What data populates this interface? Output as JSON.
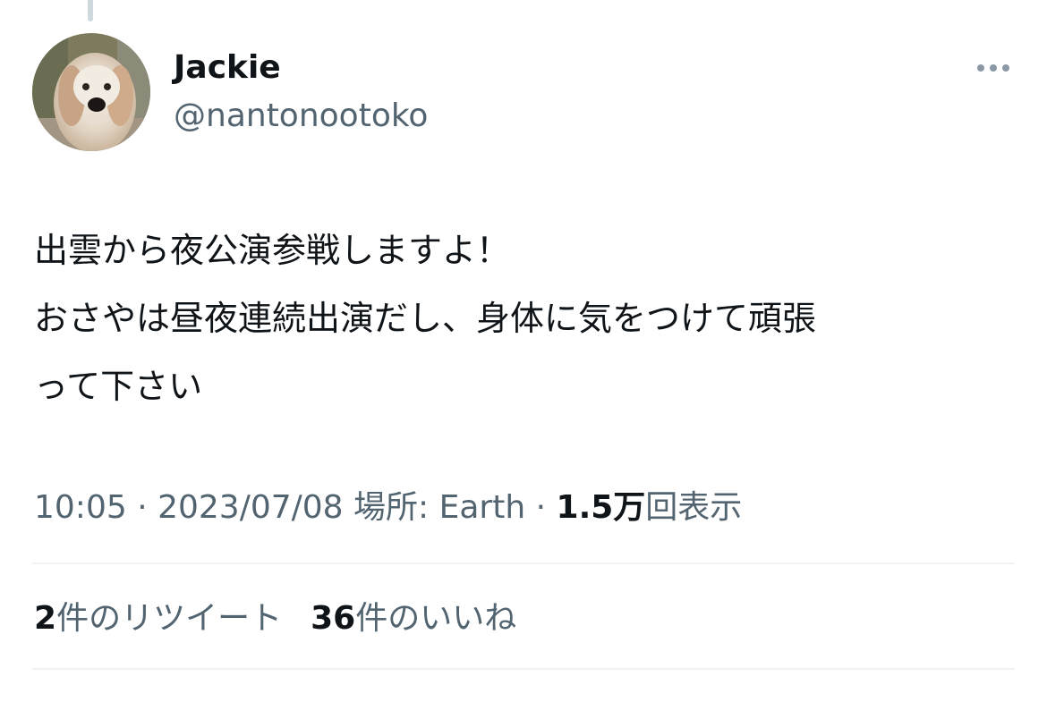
{
  "tweet": {
    "author": {
      "display_name": "Jackie",
      "handle": "@nantonootoko",
      "avatar": "dog-avatar-icon"
    },
    "more_icon": "more-horizontal-icon",
    "text_lines": [
      "出雲から夜公演参戦しますよ！",
      "おさやは昼夜連続出演だし、身体に気をつけて頑張",
      "って下さい"
    ],
    "meta": {
      "time": "10:05",
      "separator": " · ",
      "date": "2023/07/08",
      "location_label": " 場所: ",
      "location": "Earth",
      "views_count": "1.5万",
      "views_label": "回表示"
    },
    "stats": {
      "retweets_count": "2",
      "retweets_label": "件のリツイート",
      "likes_count": "36",
      "likes_label": "件のいいね"
    }
  },
  "colors": {
    "primary_text": "#0f1419",
    "secondary_text": "#536471",
    "divider": "#eff3f4",
    "thread_line": "#cfd9de"
  }
}
